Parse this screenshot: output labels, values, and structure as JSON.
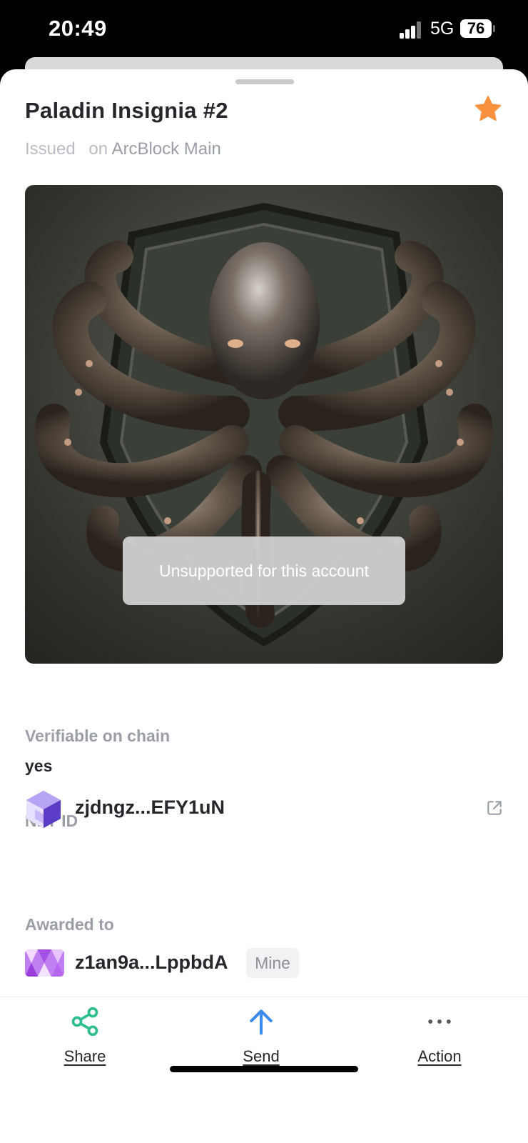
{
  "status_bar": {
    "time": "20:49",
    "network": "5G",
    "battery": "76",
    "icons": [
      "signal-icon",
      "battery-icon"
    ]
  },
  "nft": {
    "title": "Paladin Insignia #2",
    "issued_prefix": "Issued",
    "on_word": "on",
    "chain": "ArcBlock Main",
    "favorite_icon": "star-icon",
    "favorite_color": "#F7913D",
    "image_alt": "octopus shield artwork"
  },
  "toast": {
    "message": "Unsupported for this account"
  },
  "details": {
    "verifiable_label": "Verifiable on chain",
    "verifiable_value": "yes",
    "nft_id_label": "NFT ID",
    "nft_id_value": "zjdngz...EFY1uN",
    "awarded_label": "Awarded to",
    "awarded_value": "z1an9a...LppbdA",
    "mine_badge": "Mine"
  },
  "actions": {
    "share": {
      "label": "Share",
      "icon": "share-icon",
      "color": "#2EBD8E"
    },
    "send": {
      "label": "Send",
      "icon": "arrow-up-icon",
      "color": "#3B8BEA"
    },
    "action": {
      "label": "Action",
      "icon": "more-icon",
      "color": "#55585F"
    }
  }
}
